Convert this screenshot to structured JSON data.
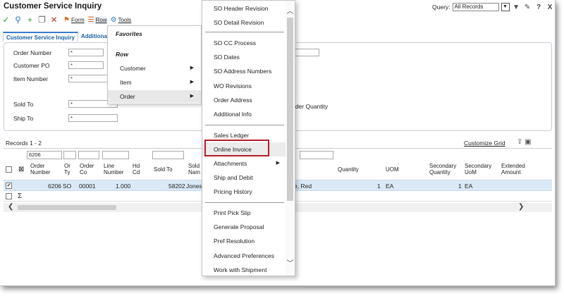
{
  "app": {
    "title": "Customer Service Inquiry"
  },
  "query": {
    "label": "Query:",
    "value": "All Records"
  },
  "title_icons": [
    "filter-icon",
    "edit-icon",
    "help-icon",
    "close-icon"
  ],
  "toolbar": {
    "form_label": "Form",
    "row_label": "Row",
    "tools_label": "Tools"
  },
  "tabs": [
    "Customer Service Inquiry",
    "Additional"
  ],
  "form": {
    "order_number_label": "Order Number",
    "order_number_value": "*",
    "customer_po_label": "Customer PO",
    "customer_po_value": "*",
    "item_number_label": "Item Number",
    "item_number_value": "*",
    "sold_to_label": "Sold To",
    "sold_to_value": "*",
    "ship_to_label": "Ship To",
    "ship_to_value": "*",
    "order_quantity_label": "rder Quantity"
  },
  "grid": {
    "records": "Records 1 - 2",
    "customize": "Customize Grid",
    "filter_order": "6206",
    "headers": {
      "order_number": "Order Number",
      "or_ty": "Or Ty",
      "order_co": "Order Co",
      "line_number": "Line Number",
      "hd_cd": "Hd Cd",
      "sold_to": "Sold To",
      "sold_name": "Sold Nam",
      "quantity": "Quantity",
      "uom": "UOM",
      "secondary_quantity": "Secondary Quantity",
      "secondary_uom": "Secondary UoM",
      "extended_amount": "Extended Amount"
    },
    "row": {
      "order_number": "6206",
      "or_ty": "SO",
      "order_co": "00001",
      "line_number": "1.000",
      "sold_to": "58202",
      "sold_name": "Jones",
      "desc": "e, Red",
      "quantity": "1",
      "uom": "EA",
      "secondary_quantity": "1",
      "secondary_uom": "EA"
    },
    "sum_symbol": "Σ"
  },
  "row_menu": {
    "favorites": "Favorites",
    "row": "Row",
    "items": [
      "Customer",
      "Item",
      "Order"
    ]
  },
  "order_menu": {
    "items": [
      "SO Header Revision",
      "SO Detail Revision",
      "SO CC Process",
      "SO Dates",
      "SO Address Numbers",
      "WO Revisions",
      "Order Address",
      "Additional Info",
      "Sales Ledger",
      "Online Invoice",
      "Attachments",
      "Ship and Debit",
      "Pricing History",
      "Print Pick Slip",
      "Generate Proposal",
      "Pref Resolution",
      "Advanced Preferences",
      "Work with Shipment"
    ]
  },
  "colors": {
    "accent": "#3a7bc8",
    "highlight_border": "#b51d2a",
    "selected_row": "#dbe9f6"
  }
}
